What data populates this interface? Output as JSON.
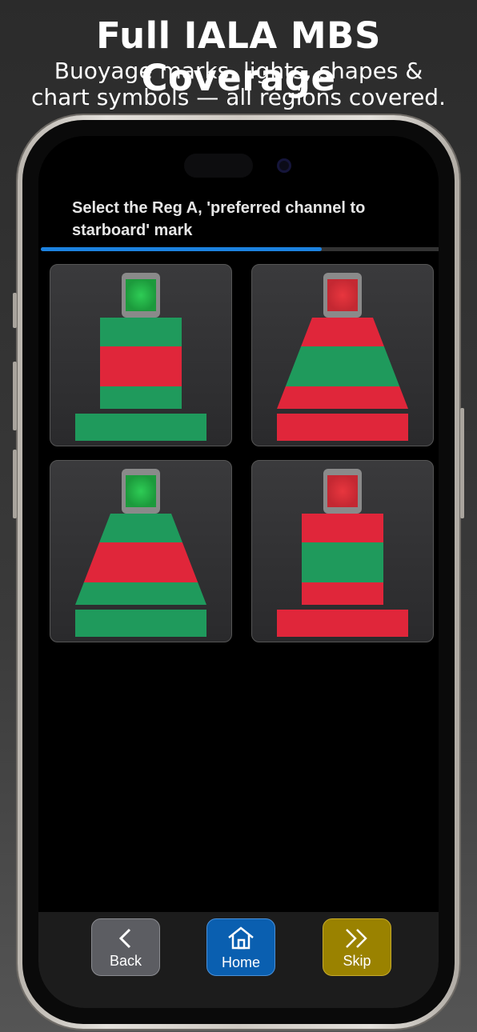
{
  "promo": {
    "title": "Full IALA MBS Coverage",
    "subtitle_line1": "Buoyage marks, lights, shapes &",
    "subtitle_line2": "chart symbols — all regions covered."
  },
  "quiz": {
    "question": "Select the Reg A, 'preferred channel to starboard' mark",
    "progress_fraction": 0.7,
    "options": [
      {
        "shape": "pillar",
        "light": "green",
        "bands": [
          "green",
          "red",
          "green"
        ],
        "base": "green"
      },
      {
        "shape": "conical",
        "light": "red",
        "bands": [
          "red",
          "green",
          "red"
        ],
        "base": "red"
      },
      {
        "shape": "conical",
        "light": "green",
        "bands": [
          "green",
          "red",
          "green"
        ],
        "base": "green"
      },
      {
        "shape": "pillar",
        "light": "red",
        "bands": [
          "red",
          "green",
          "red"
        ],
        "base": "red"
      }
    ]
  },
  "nav": {
    "back_label": "Back",
    "home_label": "Home",
    "skip_label": "Skip",
    "back_icon": "chevron-left-icon",
    "home_icon": "home-icon",
    "skip_icon": "double-chevron-right-icon"
  },
  "colors": {
    "green": "#1f9a5c",
    "red": "#e0263a",
    "progress": "#1c82e0",
    "back_button": "#5c5d62",
    "home_button": "#0a5fb0",
    "skip_button": "#9a8200"
  }
}
